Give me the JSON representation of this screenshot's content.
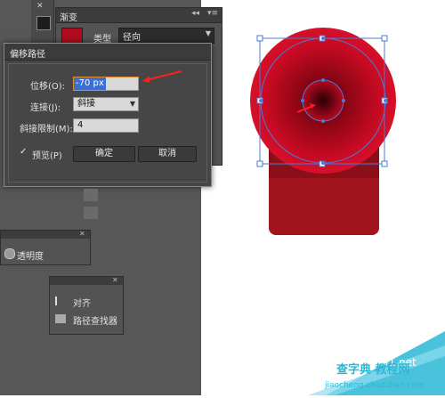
{
  "gradient_panel": {
    "title": "渐变",
    "type_label": "类型",
    "type_value": "径向",
    "swatch_color": "#b00c1d"
  },
  "dialog": {
    "title": "偏移路径",
    "offset_label": "位移(O):",
    "offset_value": "-70 px",
    "join_label": "连接(J):",
    "join_value": "斜接",
    "miter_label": "斜接限制(M):",
    "miter_value": "4",
    "preview_label": "预览(P)",
    "preview_checked": "✓",
    "ok_label": "确定",
    "cancel_label": "取消"
  },
  "transparency_panel": {
    "label": "透明度"
  },
  "align_panel": {
    "align_label": "对齐",
    "pathfinder_label": "路径查找器"
  },
  "watermark": {
    "main": "查字典 教程网",
    "sub": "jiaocheng.chazidian.com",
    "site": "jb51.net"
  },
  "colors": {
    "accent_red": "#b00c1d",
    "selection_blue": "#3c6fd0",
    "watermark_blue": "#2bb7d6"
  }
}
